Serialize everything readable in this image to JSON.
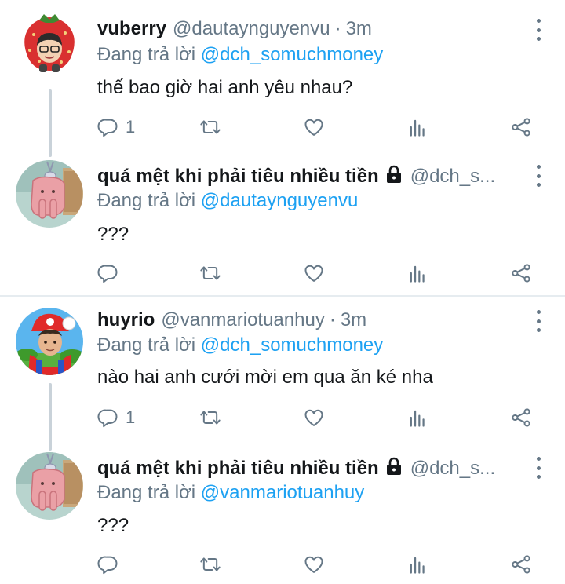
{
  "tweets": [
    {
      "name": "vuberry",
      "handle": "@dautaynguyenvu",
      "dot": "·",
      "time": "3m",
      "reply_prefix": "Đang trả lời ",
      "reply_to": "@dch_somuchmoney",
      "text": "thế bao giờ hai anh yêu nhau?",
      "reply_count": "1"
    },
    {
      "name": "quá mệt khi phải tiêu nhiều tiền",
      "handle": "@dch_s...",
      "locked": true,
      "reply_prefix": "Đang trả lời ",
      "reply_to": "@dautaynguyenvu",
      "text": "???",
      "reply_count": ""
    },
    {
      "name": "huyrio",
      "handle": "@vanmariotuanhuy",
      "dot": "·",
      "time": "3m",
      "reply_prefix": "Đang trả lời ",
      "reply_to": "@dch_somuchmoney",
      "text": "nào hai anh cưới mời em qua ăn ké nha",
      "reply_count": "1"
    },
    {
      "name": "quá mệt khi phải tiêu nhiều tiền",
      "handle": "@dch_s...",
      "locked": true,
      "reply_prefix": "Đang trả lời ",
      "reply_to": "@vanmariotuanhuy",
      "text": "???",
      "reply_count": ""
    }
  ],
  "icons": {
    "reply": "reply-icon",
    "retweet": "retweet-icon",
    "like": "heart-icon",
    "analytics": "analytics-icon",
    "share": "share-icon",
    "more": "more-vertical-icon",
    "lock": "lock-icon"
  },
  "colors": {
    "text": "#14171a",
    "secondary": "#657786",
    "link": "#1da1f2",
    "connector": "#c9d2d9",
    "divider": "#e6ecf0"
  }
}
